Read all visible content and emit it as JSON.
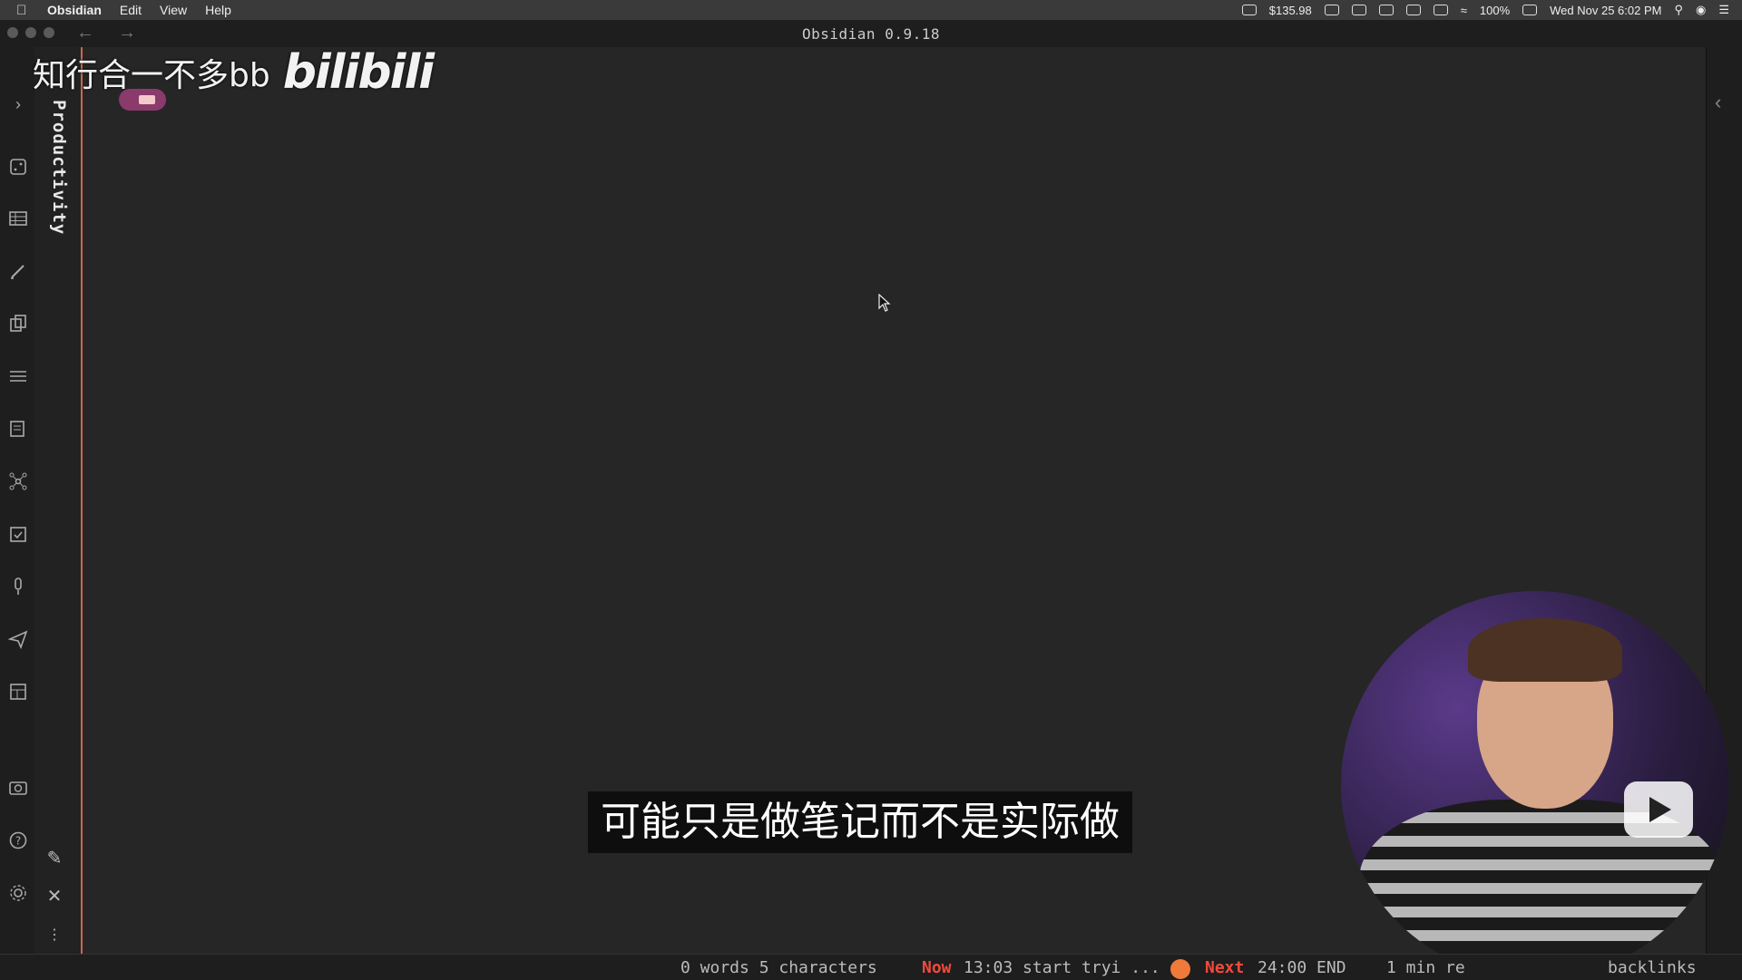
{
  "menubar": {
    "app_name": "Obsidian",
    "menus": [
      "Edit",
      "View",
      "Help"
    ],
    "stock_value": "$135.98",
    "battery": "100%",
    "datetime": "Wed Nov 25  6:02 PM"
  },
  "window": {
    "title": "Obsidian 0.9.18",
    "nav_back": "←",
    "nav_forward": "→"
  },
  "sidebar_tab": {
    "title": "Productivity"
  },
  "watermark": {
    "channel": "知行合一不多bb",
    "logo": "bilibili"
  },
  "subtitle": {
    "text": "可能只是做笔记而不是实际做"
  },
  "statusbar": {
    "word_count": "0 words 5 characters",
    "now_label": "Now",
    "now_text": "13:03 start tryi ...",
    "next_label": "Next",
    "next_text": "24:00 END",
    "reading_time": "1 min re",
    "backlinks": "backlinks"
  },
  "colors": {
    "accent": "#c8674a",
    "tag_pill": "#8b3a6c",
    "status_red": "#f24a3b",
    "pomodoro": "#f07a3a"
  },
  "icons": {
    "ribbon": [
      "expand-chevron-icon",
      "random-note-icon",
      "table-icon",
      "pencil-icon",
      "copy-icon",
      "menu-icon",
      "outline-icon",
      "graph-icon",
      "calendar-check-icon",
      "microphone-icon",
      "send-icon",
      "layout-icon",
      "camera-icon",
      "help-icon",
      "settings-icon"
    ]
  }
}
